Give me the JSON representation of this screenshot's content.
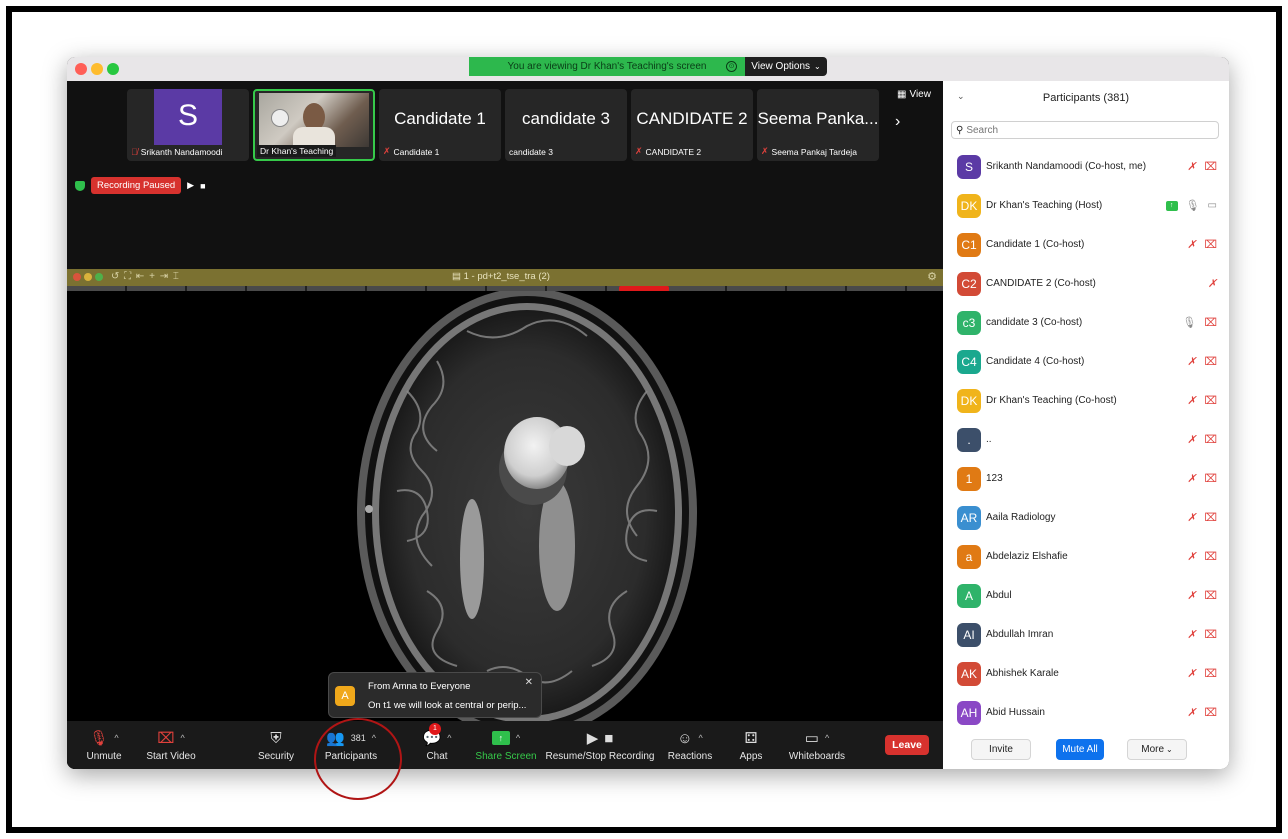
{
  "window": {
    "viewing_banner": "You are viewing Dr Khan's Teaching's screen",
    "view_options": "View Options"
  },
  "thumbnails": [
    {
      "big": "S",
      "caption": "Srikanth Nandamoodi",
      "muted": true
    },
    {
      "big": "",
      "caption": "Dr Khan's Teaching",
      "muted": false
    },
    {
      "big": "Candidate 1",
      "caption": "Candidate 1",
      "muted": true
    },
    {
      "big": "candidate 3",
      "caption": "candidate 3",
      "muted": false
    },
    {
      "big": "CANDIDATE 2",
      "caption": "CANDIDATE 2",
      "muted": true
    },
    {
      "big": "Seema Panka...",
      "caption": "Seema Pankaj Tardeja",
      "muted": true
    }
  ],
  "view_button": "View",
  "recording": {
    "status": "Recording Paused"
  },
  "viewer": {
    "title": "1 - pd+t2_tse_tra (2)"
  },
  "chat_toast": {
    "avatar": "A",
    "from": "From Amna to Everyone",
    "message": "On t1 we will look at central or perip..."
  },
  "toolbar": {
    "unmute": "Unmute",
    "start_video": "Start Video",
    "security": "Security",
    "participants": "Participants",
    "participants_count": "381",
    "chat": "Chat",
    "chat_badge": "1",
    "share_screen": "Share Screen",
    "recording": "Resume/Stop Recording",
    "reactions": "Reactions",
    "apps": "Apps",
    "whiteboards": "Whiteboards",
    "leave": "Leave"
  },
  "panel": {
    "title": "Participants (381)",
    "search_placeholder": "Search",
    "participants": [
      {
        "initials": "S",
        "name": "Srikanth Nandamoodi (Co-host, me)",
        "color": "#5b3aa5",
        "mic": "off",
        "video": "off"
      },
      {
        "initials": "DK",
        "name": "Dr Khan's Teaching (Host)",
        "color": "#f0b41b",
        "mic": "on",
        "video": "on",
        "sharing": true
      },
      {
        "initials": "C1",
        "name": "Candidate 1 (Co-host)",
        "color": "#e07a14",
        "mic": "off",
        "video": "off"
      },
      {
        "initials": "C2",
        "name": "CANDIDATE 2 (Co-host)",
        "color": "#d24a36",
        "mic": "off",
        "video": "none"
      },
      {
        "initials": "c3",
        "name": "candidate 3 (Co-host)",
        "color": "#2fb36a",
        "mic": "on",
        "video": "off"
      },
      {
        "initials": "C4",
        "name": "Candidate 4 (Co-host)",
        "color": "#1aa88e",
        "mic": "off",
        "video": "off"
      },
      {
        "initials": "DK",
        "name": "Dr Khan's Teaching (Co-host)",
        "color": "#f0b41b",
        "mic": "off",
        "video": "off"
      },
      {
        "initials": ".",
        "name": "..",
        "color": "#3c4f6a",
        "mic": "off",
        "video": "off"
      },
      {
        "initials": "1",
        "name": "123",
        "color": "#e07a14",
        "mic": "off",
        "video": "off"
      },
      {
        "initials": "AR",
        "name": "Aaila Radiology",
        "color": "#3a8fd0",
        "mic": "off",
        "video": "off"
      },
      {
        "initials": "a",
        "name": "Abdelaziz Elshafie",
        "color": "#e07a14",
        "mic": "off",
        "video": "off"
      },
      {
        "initials": "A",
        "name": "Abdul",
        "color": "#2fb36a",
        "mic": "off",
        "video": "off"
      },
      {
        "initials": "AI",
        "name": "Abdullah Imran",
        "color": "#3c4f6a",
        "mic": "off",
        "video": "off"
      },
      {
        "initials": "AK",
        "name": "Abhishek Karale",
        "color": "#d24a36",
        "mic": "off",
        "video": "off"
      },
      {
        "initials": "AH",
        "name": "Abid Hussain",
        "color": "#8a48c5",
        "mic": "off",
        "video": "off"
      }
    ],
    "invite": "Invite",
    "mute_all": "Mute All",
    "more": "More"
  },
  "colors": {
    "accent_blue": "#0e72ed",
    "leave_red": "#d7322e",
    "share_green": "#2fbf4c"
  }
}
